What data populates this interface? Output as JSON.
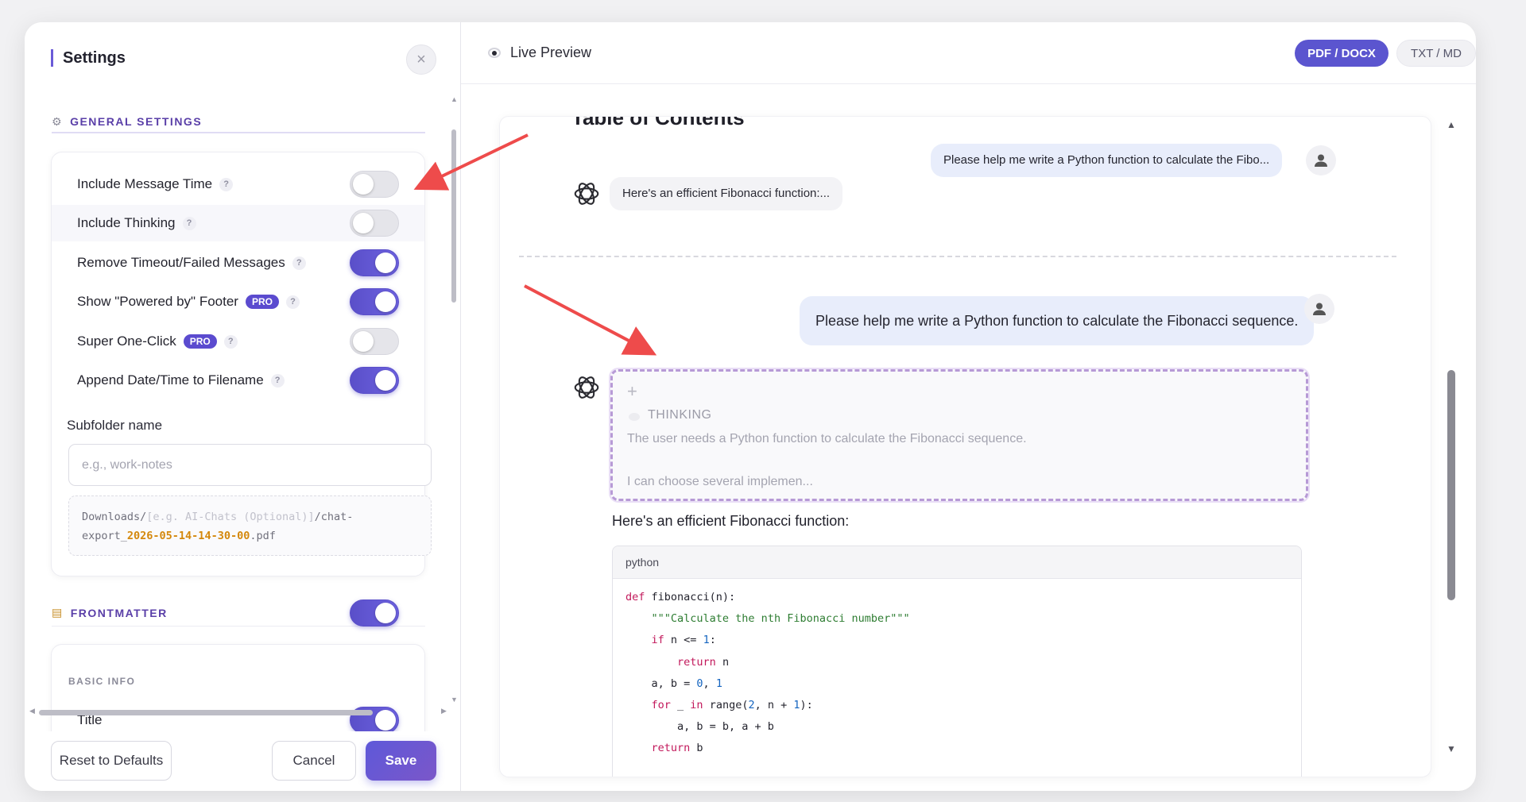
{
  "settings": {
    "title": "Settings",
    "close_icon": "close-icon",
    "general": {
      "heading": "GENERAL SETTINGS",
      "icon": "gear-icon",
      "options": [
        {
          "label": "Include Message Time",
          "pro": false,
          "on": false
        },
        {
          "label": "Include Thinking",
          "pro": false,
          "on": false
        },
        {
          "label": "Remove Timeout/Failed Messages",
          "pro": false,
          "on": true
        },
        {
          "label": "Show \"Powered by\" Footer",
          "pro": true,
          "on": true
        },
        {
          "label": "Super One-Click",
          "pro": true,
          "on": false
        },
        {
          "label": "Append Date/Time to Filename",
          "pro": false,
          "on": true
        }
      ],
      "help_glyph": "?",
      "pro_badge": "PRO",
      "subfolder_label": "Subfolder name",
      "subfolder_placeholder": "e.g., work-notes",
      "path_prefix": "Downloads/",
      "path_placeholder": "[e.g. AI-Chats (Optional)]",
      "path_mid": "/chat-export_",
      "path_timestamp": "2026-05-14-14-30-00",
      "path_ext": ".pdf"
    },
    "frontmatter": {
      "heading": "FRONTMATTER",
      "icon": "document-icon",
      "on": true,
      "basic_info_heading": "BASIC INFO",
      "title_label": "Title",
      "title_on": true
    },
    "footer": {
      "reset_label": "Reset to Defaults",
      "cancel_label": "Cancel",
      "save_label": "Save"
    }
  },
  "preview": {
    "title": "Live Preview",
    "format_active": "PDF / DOCX",
    "format_inactive": "TXT / MD",
    "toc_title": "Table of Contents",
    "toc_user_msg": "Please help me write a Python function to calculate the Fibo...",
    "toc_ai_msg": "Here's an efficient Fibonacci function:...",
    "user_msg": "Please help me write a Python function to calculate the Fibonacci sequence.",
    "thinking_label": "THINKING",
    "thinking_line1": "The user needs a Python function to calculate the Fibonacci sequence.",
    "thinking_line2": "I can choose several implemen...",
    "answer_text": "Here's an efficient Fibonacci function:",
    "code_lang": "python",
    "code_lines": [
      "def fibonacci(n):",
      "    \"\"\"Calculate the nth Fibonacci number\"\"\"",
      "    if n <= 1:",
      "        return n",
      "    a, b = 0, 1",
      "    for _ in range(2, n + 1):",
      "        a, b = b, a + b",
      "    return b"
    ]
  },
  "colors": {
    "accent": "#5b55cf",
    "annotation": "#ee4b4b",
    "thinking_border": "#b79ad6",
    "timestamp": "#d4880c"
  }
}
